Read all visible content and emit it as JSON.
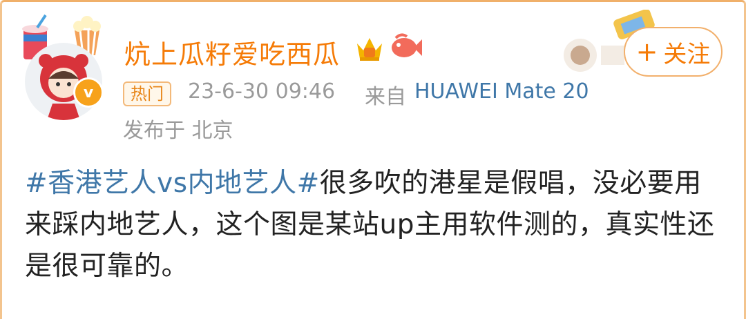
{
  "post": {
    "username": "炕上瓜籽爱吃西瓜",
    "tag": "热门",
    "time": "23-6-30 09:46",
    "from_label": "来自",
    "device": "HUAWEI Mate 20",
    "location": "发布于 北京",
    "follow_plus": "+",
    "follow_label": "关注",
    "hashtag": "#香港艺人vs内地艺人#",
    "body": "很多吹的港星是假唱，没必要用来踩内地艺人，这个图是某站up主用软件测的，真实性还是很可靠的。",
    "verified_glyph": "v"
  },
  "icons": [
    "soda-cup-icon",
    "popcorn-icon",
    "crown-icon",
    "fish-icon",
    "verified-badge-icon"
  ],
  "colors": {
    "name": "#f57b07",
    "link": "#3f77a8",
    "meta": "#9a9a9a",
    "accent_border": "#f2b06c"
  }
}
